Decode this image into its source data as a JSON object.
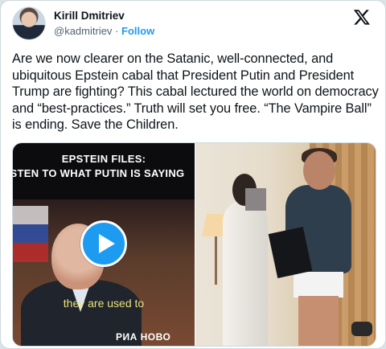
{
  "author": {
    "name": "Kirill Dmitriev",
    "handle": "@kadmitriev",
    "separator": "·",
    "follow_label": "Follow"
  },
  "platform_icon": "x-logo-icon",
  "tweet": {
    "text": "Are we now clearer on the Satanic, well-connected, and ubiquitous Epstein cabal that President Putin and President Trump are fighting?  This cabal lectured the world on democracy and “best-practices.”  Truth will set you free. “The Vampire Ball” is ending. Save the Children."
  },
  "media": {
    "video": {
      "caption_line1": "EPSTEIN FILES:",
      "caption_line2": "STEN TO WHAT PUTIN IS SAYING",
      "subtitle": "they are used to",
      "watermark": "РИА НОВО",
      "play_icon": "play-icon"
    },
    "photo": {
      "description_icon": "photo-image"
    }
  },
  "colors": {
    "accent": "#1d9bf0",
    "text": "#0f1419",
    "secondary": "#536471",
    "subtitle": "#e9e27a"
  }
}
